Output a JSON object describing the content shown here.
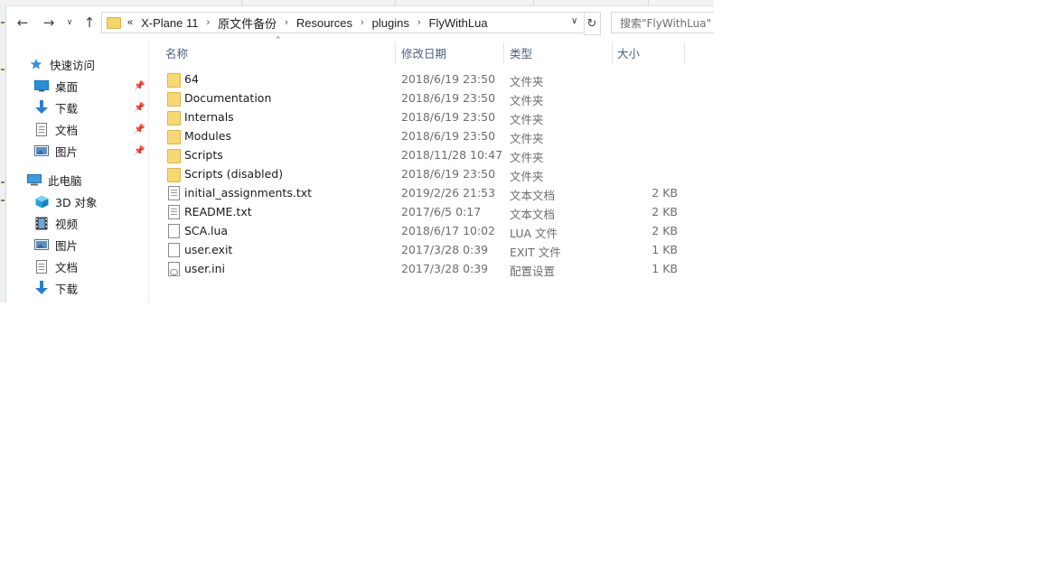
{
  "nav": {
    "back_icon": "arrow-left-icon",
    "forward_icon": "arrow-right-icon",
    "recent_icon": "chevron-down-icon",
    "up_icon": "arrow-up-icon"
  },
  "address": {
    "overflow": "«",
    "crumbs": [
      "X-Plane 11",
      "原文件备份",
      "Resources",
      "plugins",
      "FlyWithLua"
    ]
  },
  "search": {
    "placeholder": "搜索\"FlyWithLua\""
  },
  "sidebar": {
    "quick_access": "快速访问",
    "pinned": [
      {
        "label": "桌面",
        "icon": "desktop-icon"
      },
      {
        "label": "下载",
        "icon": "download-icon"
      },
      {
        "label": "文档",
        "icon": "document-icon"
      },
      {
        "label": "图片",
        "icon": "picture-icon"
      }
    ],
    "this_pc": "此电脑",
    "pc_items": [
      {
        "label": "3D 对象",
        "icon": "3d-objects-icon"
      },
      {
        "label": "视频",
        "icon": "video-icon"
      },
      {
        "label": "图片",
        "icon": "picture-icon"
      },
      {
        "label": "文档",
        "icon": "document-icon"
      },
      {
        "label": "下载",
        "icon": "download-icon"
      }
    ]
  },
  "columns": {
    "name": "名称",
    "date": "修改日期",
    "type": "类型",
    "size": "大小"
  },
  "files": [
    {
      "name": "64",
      "date": "2018/6/19 23:50",
      "type": "文件夹",
      "size": "",
      "icon": "folder-icon"
    },
    {
      "name": "Documentation",
      "date": "2018/6/19 23:50",
      "type": "文件夹",
      "size": "",
      "icon": "folder-icon"
    },
    {
      "name": "Internals",
      "date": "2018/6/19 23:50",
      "type": "文件夹",
      "size": "",
      "icon": "folder-icon"
    },
    {
      "name": "Modules",
      "date": "2018/6/19 23:50",
      "type": "文件夹",
      "size": "",
      "icon": "folder-icon"
    },
    {
      "name": "Scripts",
      "date": "2018/11/28 10:47",
      "type": "文件夹",
      "size": "",
      "icon": "folder-icon"
    },
    {
      "name": "Scripts (disabled)",
      "date": "2018/6/19 23:50",
      "type": "文件夹",
      "size": "",
      "icon": "folder-icon"
    },
    {
      "name": "initial_assignments.txt",
      "date": "2019/2/26 21:53",
      "type": "文本文档",
      "size": "2 KB",
      "icon": "text-file-icon"
    },
    {
      "name": "README.txt",
      "date": "2017/6/5 0:17",
      "type": "文本文档",
      "size": "2 KB",
      "icon": "text-file-icon"
    },
    {
      "name": "SCA.lua",
      "date": "2018/6/17 10:02",
      "type": "LUA 文件",
      "size": "2 KB",
      "icon": "file-icon"
    },
    {
      "name": "user.exit",
      "date": "2017/3/28 0:39",
      "type": "EXIT 文件",
      "size": "1 KB",
      "icon": "file-icon"
    },
    {
      "name": "user.ini",
      "date": "2017/3/28 0:39",
      "type": "配置设置",
      "size": "1 KB",
      "icon": "config-file-icon"
    }
  ]
}
